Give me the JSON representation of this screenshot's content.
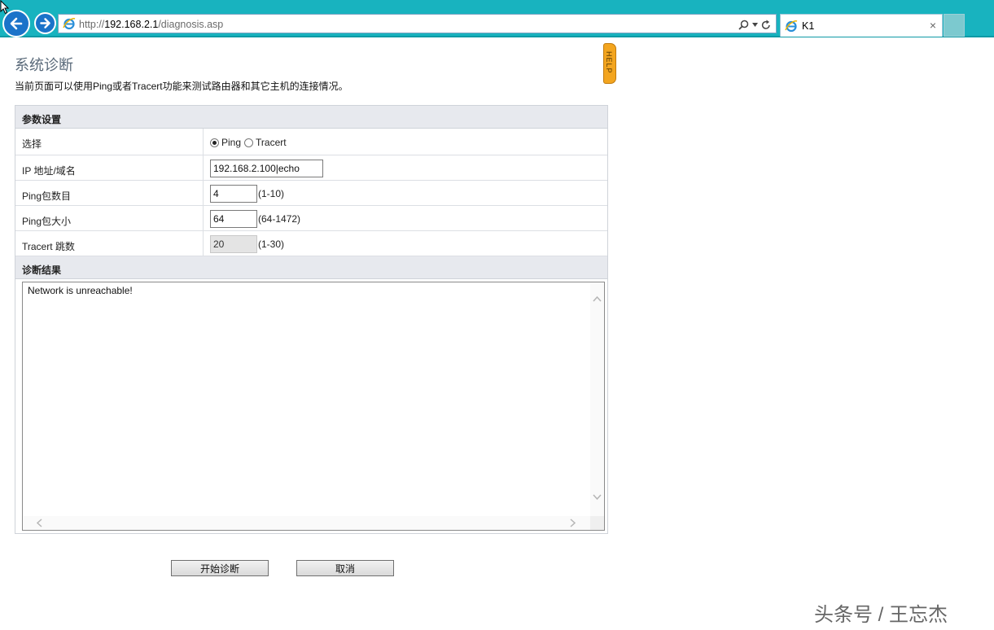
{
  "browser": {
    "url_prefix": "http://",
    "url_host": "192.168.2.1",
    "url_path": "/diagnosis.asp",
    "tab_title": "K1",
    "tab_close": "×"
  },
  "page": {
    "title": "系统诊断",
    "description": "当前页面可以使用Ping或者Tracert功能来测试路由器和其它主机的连接情况。",
    "help_label": "HELP"
  },
  "params": {
    "section_title": "参数设置",
    "select_label": "选择",
    "option_ping": "Ping",
    "option_tracert": "Tracert",
    "selected": "Ping",
    "ip_label": "IP 地址/域名",
    "ip_value": "192.168.2.100|echo",
    "count_label": "Ping包数目",
    "count_value": "4",
    "count_range": "(1-10)",
    "size_label": "Ping包大小",
    "size_value": "64",
    "size_range": "(64-1472)",
    "hops_label": "Tracert 跳数",
    "hops_value": "20",
    "hops_range": "(1-30)"
  },
  "result": {
    "section_title": "诊断结果",
    "text": "Network is unreachable!"
  },
  "buttons": {
    "start": "开始诊断",
    "cancel": "取消"
  },
  "watermark": "头条号 / 王忘杰",
  "colors": {
    "chrome": "#18b3bf",
    "section_bg": "#e7e9ee",
    "help_tab": "#f3a51f",
    "title": "#5a6a7a"
  }
}
